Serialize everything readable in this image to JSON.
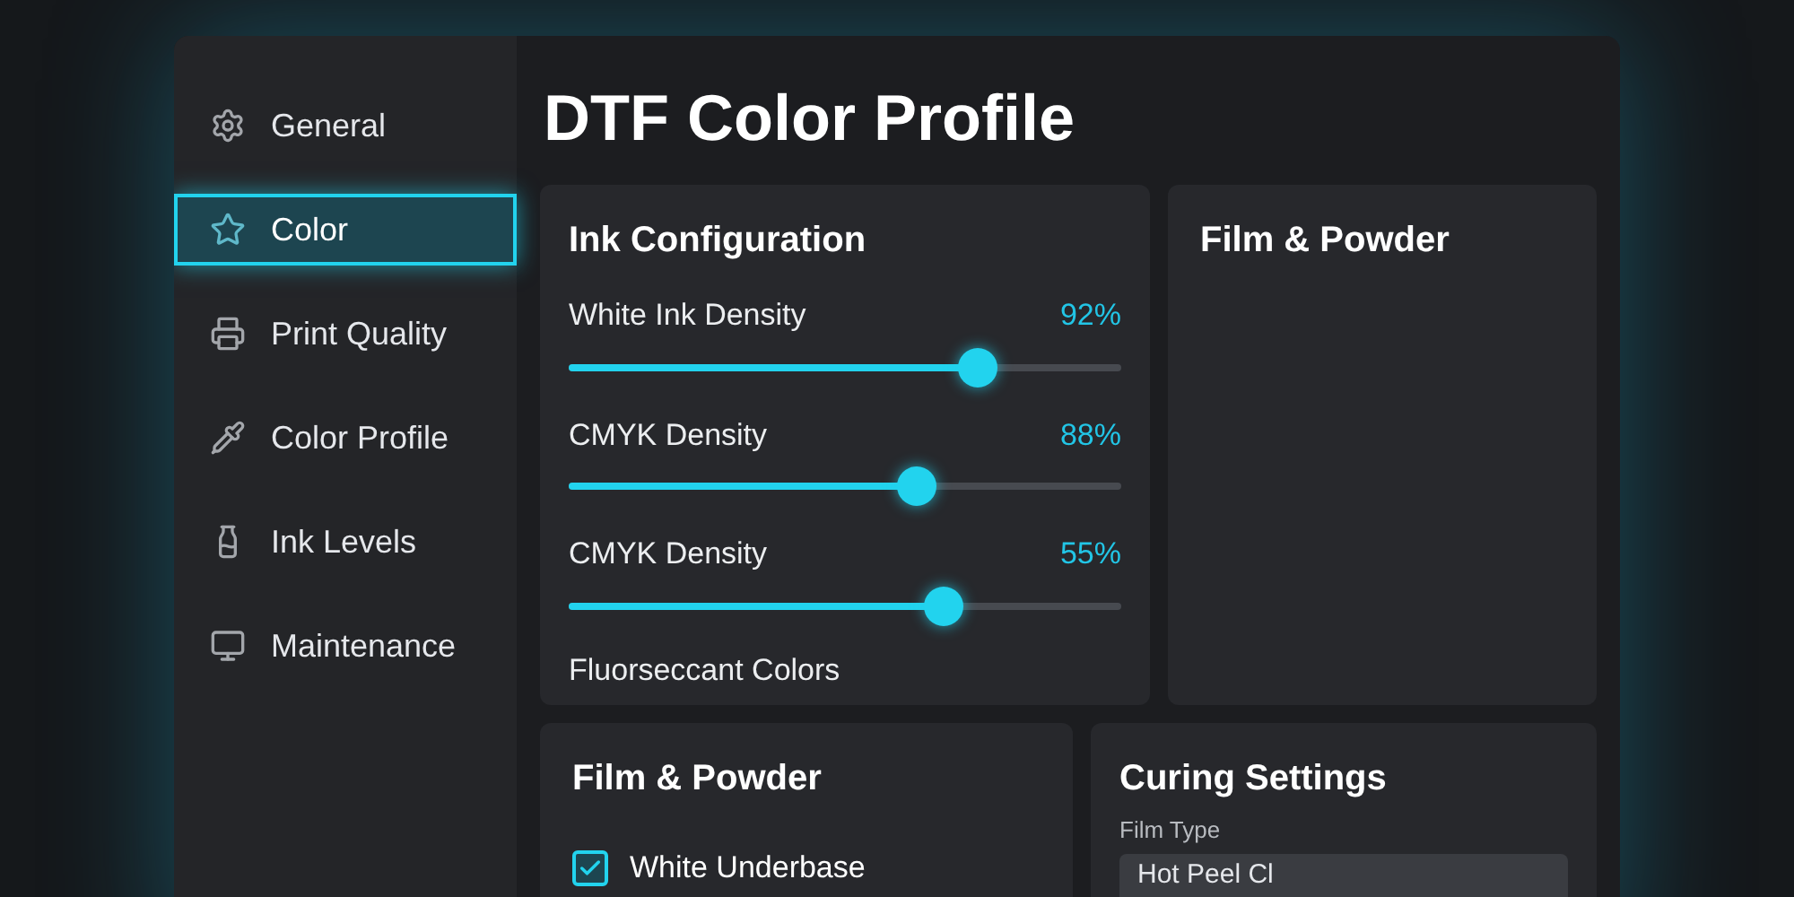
{
  "sidebar": {
    "items": [
      {
        "label": "General",
        "selected": false
      },
      {
        "label": "Color",
        "selected": true
      },
      {
        "label": "Print Quality",
        "selected": false
      },
      {
        "label": "Color Profile",
        "selected": false
      },
      {
        "label": "Ink Levels",
        "selected": false
      },
      {
        "label": "Maintenance",
        "selected": false
      }
    ]
  },
  "title": "DTF Color Profile",
  "ink_configuration": {
    "title": "Ink Configuration",
    "sliders": [
      {
        "name": "White Ink Density",
        "level": 0.74,
        "reading": "92%"
      },
      {
        "name": "CMYK Density",
        "level": 0.63,
        "reading": "88%"
      },
      {
        "name": "CMYK Density",
        "level": 0.68,
        "reading": "55%"
      }
    ],
    "footer": "Fluorseccant Colors"
  },
  "film_powder_top": {
    "title": "Film & Powder"
  },
  "film_powder": {
    "title": "Film & Powder",
    "checkbox": {
      "label": "White Underbase",
      "checked": true
    }
  },
  "curing_settings": {
    "title": "Curing Settings",
    "field_label": "Film Type",
    "field_value": "Hot Peel Cl"
  }
}
